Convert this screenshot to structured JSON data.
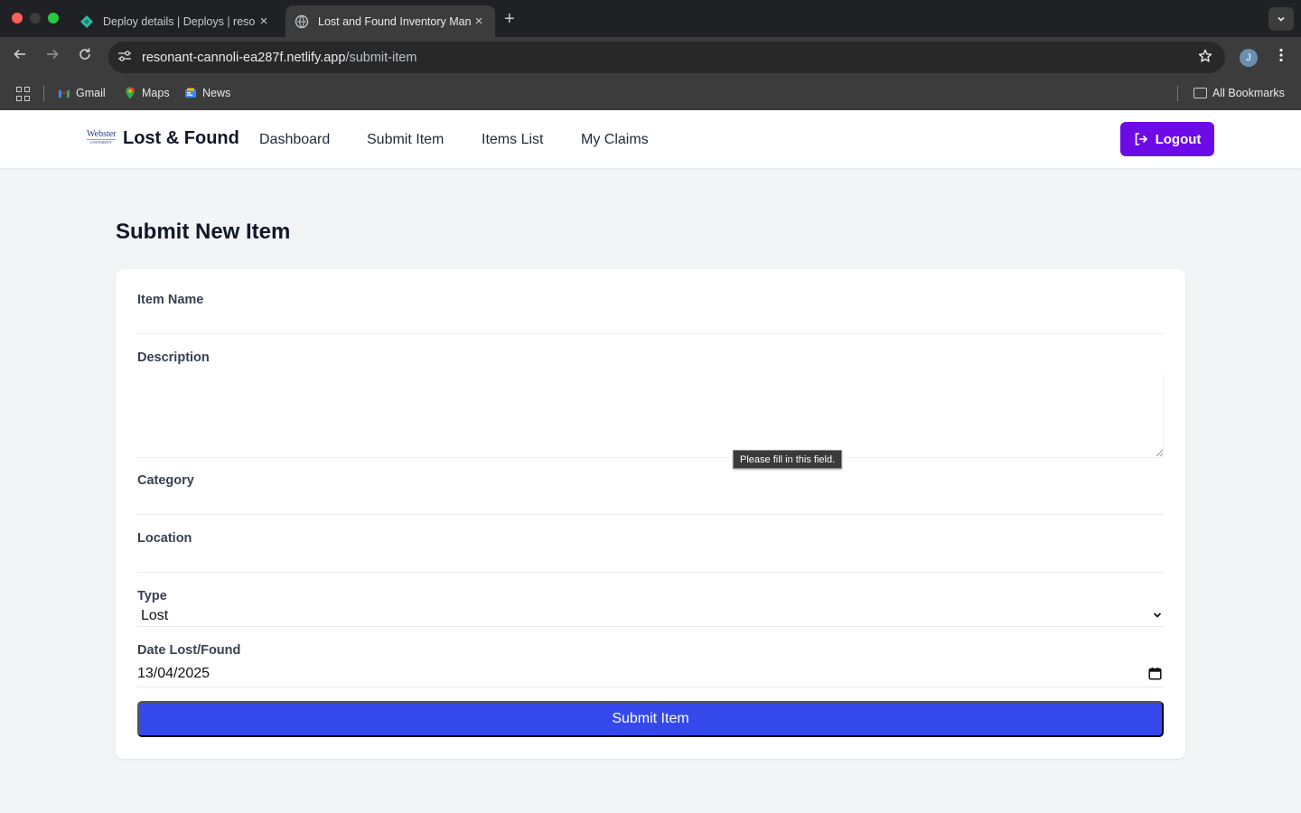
{
  "browser": {
    "tabs": [
      {
        "title": "Deploy details | Deploys | reso",
        "favicon": "netlify-icon"
      },
      {
        "title": "Lost and Found Inventory Man",
        "favicon": "globe-icon"
      }
    ],
    "url_host": "resonant-cannoli-ea287f.netlify.app",
    "url_path": "/submit-item",
    "profile_initial": "J",
    "bookmarks": [
      {
        "label": "Gmail",
        "icon": "gmail-icon"
      },
      {
        "label": "Maps",
        "icon": "maps-icon"
      },
      {
        "label": "News",
        "icon": "news-icon"
      }
    ],
    "all_bookmarks_label": "All Bookmarks"
  },
  "header": {
    "logo_text": "Webster",
    "logo_sub": "UNIVERSITY",
    "brand": "Lost & Found",
    "nav": [
      "Dashboard",
      "Submit Item",
      "Items List",
      "My Claims"
    ],
    "logout_label": "Logout"
  },
  "main": {
    "title": "Submit New Item",
    "form": {
      "item_name_label": "Item Name",
      "item_name_value": "",
      "description_label": "Description",
      "description_value": "",
      "category_label": "Category",
      "category_value": "",
      "location_label": "Location",
      "location_value": "",
      "type_label": "Type",
      "type_value": "Lost",
      "date_label": "Date Lost/Found",
      "date_value": "13/04/2025",
      "submit_label": "Submit Item"
    },
    "tooltip": "Please fill in this field."
  },
  "colors": {
    "logout_button": "#6d0be8",
    "submit_button": "#3448ec",
    "page_background": "#f3f4f6"
  }
}
